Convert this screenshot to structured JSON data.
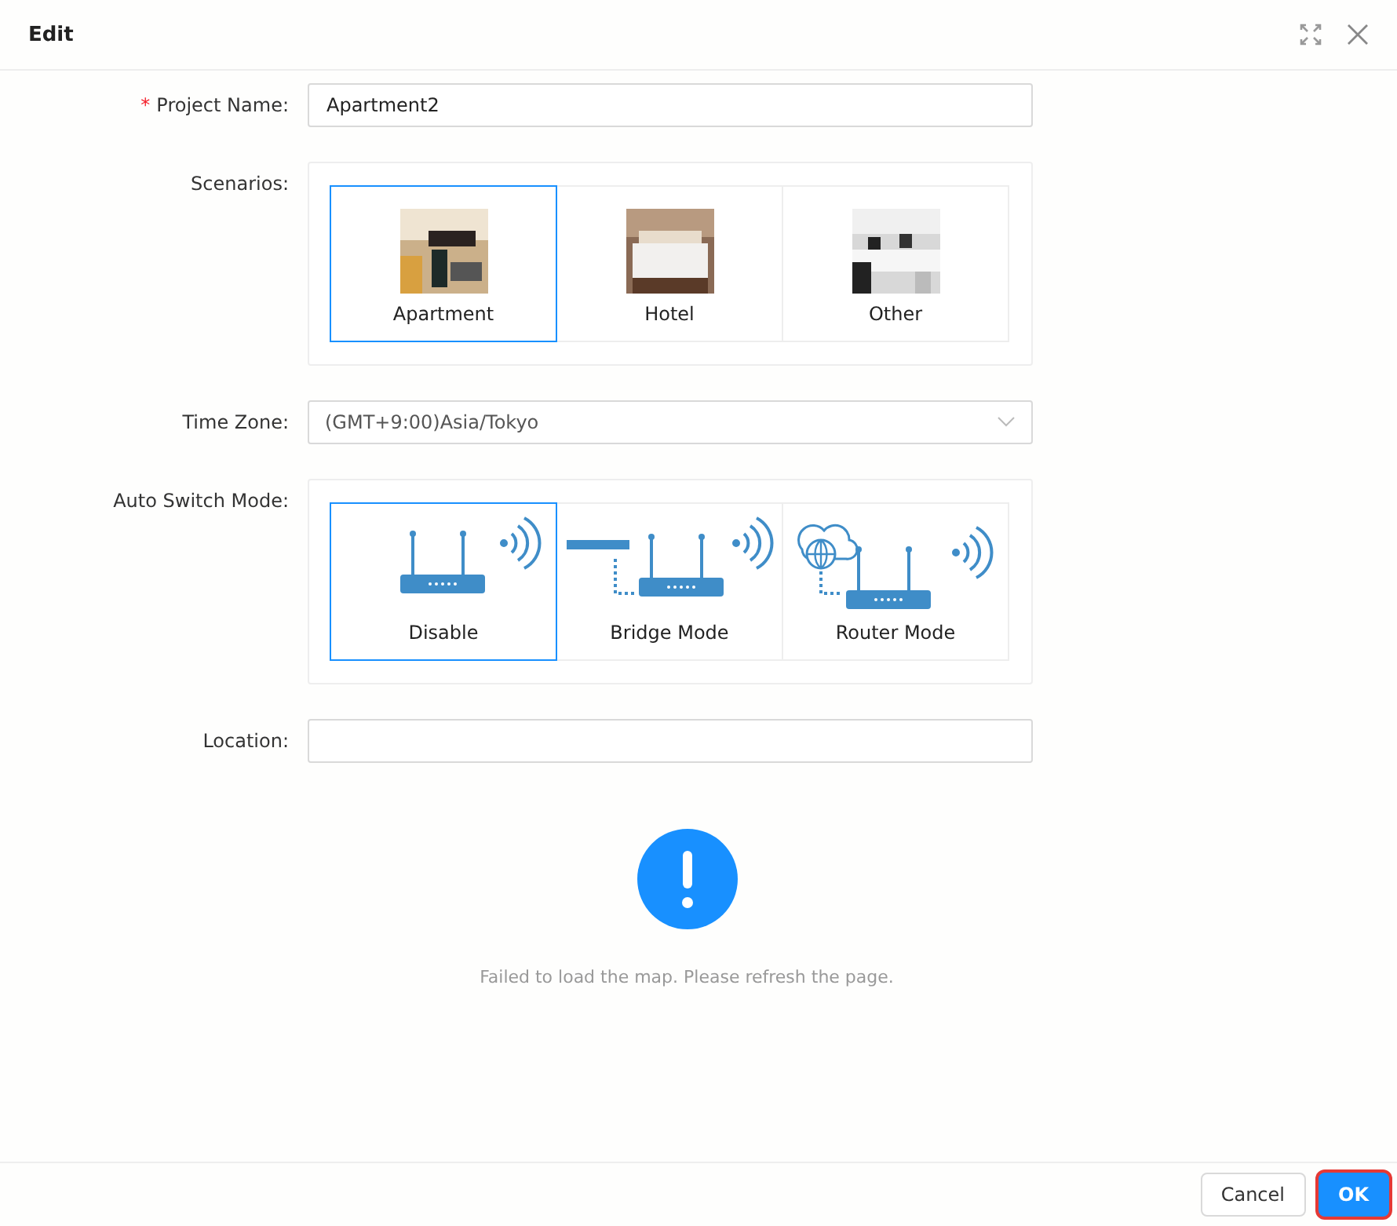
{
  "window": {
    "title": "Edit"
  },
  "fields": {
    "project_name": {
      "label": "Project Name:",
      "required_mark": "*",
      "value": "Apartment2"
    },
    "scenarios": {
      "label": "Scenarios:",
      "options": [
        {
          "label": "Apartment",
          "selected": true,
          "kind": "apartment"
        },
        {
          "label": "Hotel",
          "selected": false,
          "kind": "hotel"
        },
        {
          "label": "Other",
          "selected": false,
          "kind": "office"
        }
      ]
    },
    "time_zone": {
      "label": "Time Zone:",
      "value": "(GMT+9:00)Asia/Tokyo"
    },
    "auto_switch_mode": {
      "label": "Auto Switch Mode:",
      "options": [
        {
          "label": "Disable",
          "selected": true,
          "kind": "router"
        },
        {
          "label": "Bridge Mode",
          "selected": false,
          "kind": "bridge"
        },
        {
          "label": "Router Mode",
          "selected": false,
          "kind": "cloud"
        }
      ]
    },
    "location": {
      "label": "Location:"
    }
  },
  "map": {
    "message": "Failed to load the map. Please refresh the page."
  },
  "buttons": [
    {
      "label": "Cancel",
      "primary": false,
      "highlighted": false
    },
    {
      "label": "OK",
      "primary": true,
      "highlighted": true
    }
  ]
}
